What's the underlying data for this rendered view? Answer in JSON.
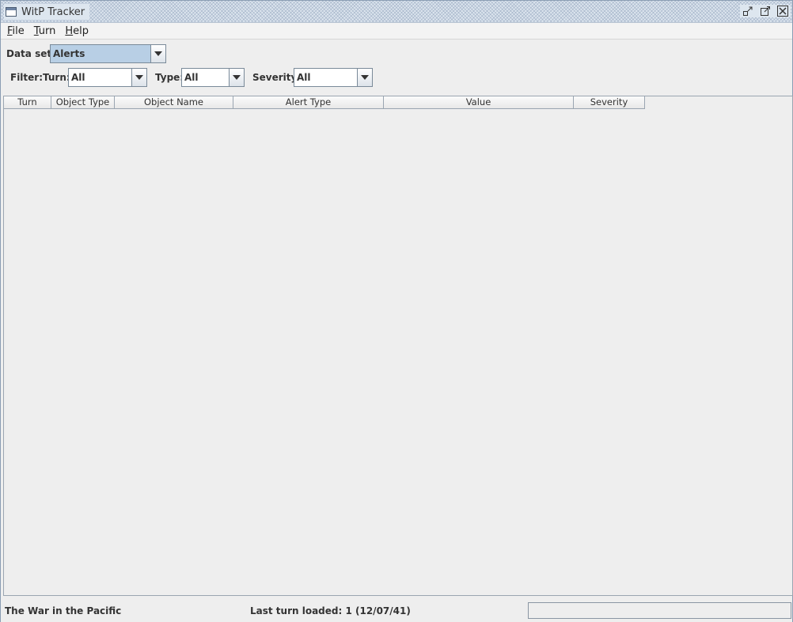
{
  "window": {
    "title": "WitP Tracker"
  },
  "menu": [
    {
      "mnemonic": "F",
      "rest": "ile"
    },
    {
      "mnemonic": "T",
      "rest": "urn"
    },
    {
      "mnemonic": "H",
      "rest": "elp"
    }
  ],
  "dataset": {
    "label": "Data set:",
    "value": "Alerts"
  },
  "filter": {
    "label": "Filter:",
    "turn": {
      "label": "Turn:",
      "value": "All"
    },
    "type": {
      "label": "Type:",
      "value": "All"
    },
    "severity": {
      "label": "Severity:",
      "value": "All"
    }
  },
  "table": {
    "columns": [
      "Turn",
      "Object Type",
      "Object Name",
      "Alert Type",
      "Value",
      "Severity"
    ],
    "rows": []
  },
  "status": {
    "left": "The War in the Pacific",
    "middle": "Last turn loaded: 1 (12/07/41)"
  },
  "icons": {
    "app": "window-icon",
    "minimize": "minimize-icon",
    "maximize": "maximize-icon",
    "close": "close-icon"
  },
  "colors": {
    "selection": "#b8cfe5",
    "titlebar": "#dde6ef",
    "background": "#eeeeee"
  }
}
